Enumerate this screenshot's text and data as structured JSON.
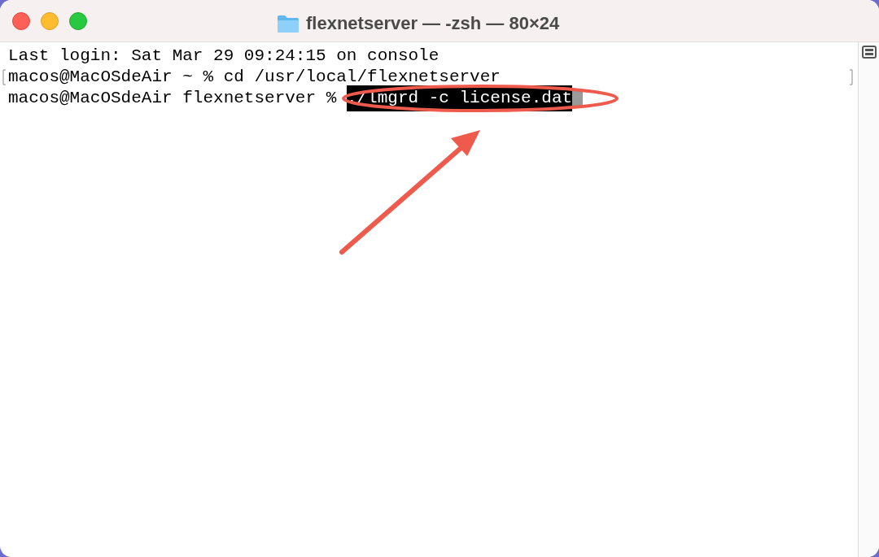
{
  "window": {
    "title": "flexnetserver — -zsh — 80×24"
  },
  "lines": [
    {
      "text": "Last login: Sat Mar 29 09:24:15 on console",
      "marked": false,
      "cursor": false
    },
    {
      "text": "macos@MacOSdeAir ~ % cd /usr/local/flexnetserver",
      "marked": true,
      "cursor": false
    },
    {
      "text": "macos@MacOSdeAir flexnetserver % ",
      "command": "./lmgrd -c license.dat",
      "selected": true,
      "marked": false,
      "cursor": true
    }
  ]
}
